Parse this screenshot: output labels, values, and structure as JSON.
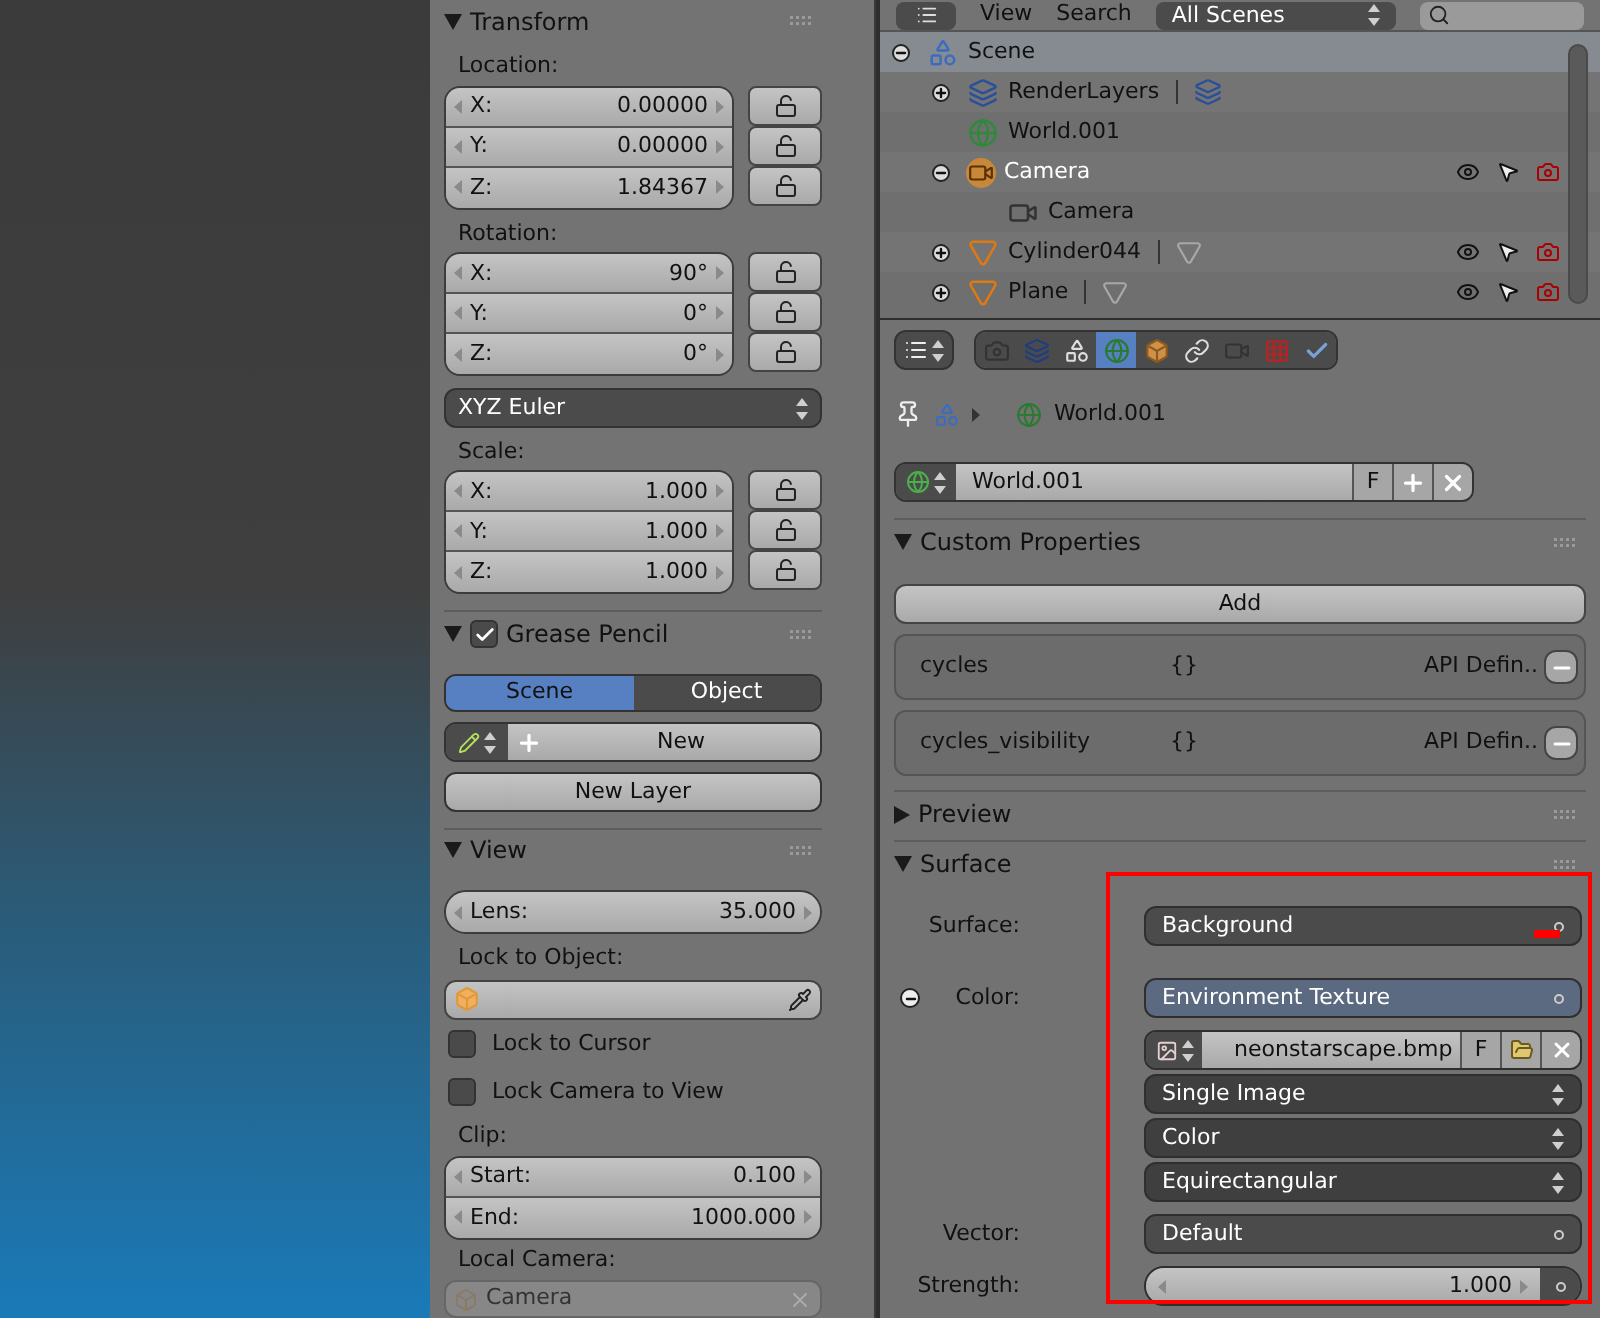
{
  "transform": {
    "title": "Transform",
    "expanded": true,
    "location": {
      "label": "Location:",
      "fields": [
        {
          "axis": "X:",
          "value": "0.00000"
        },
        {
          "axis": "Y:",
          "value": "0.00000"
        },
        {
          "axis": "Z:",
          "value": "1.84367"
        }
      ]
    },
    "rotation": {
      "label": "Rotation:",
      "fields": [
        {
          "axis": "X:",
          "value": "90°"
        },
        {
          "axis": "Y:",
          "value": "0°"
        },
        {
          "axis": "Z:",
          "value": "0°"
        }
      ]
    },
    "rotation_mode": "XYZ Euler",
    "scale": {
      "label": "Scale:",
      "fields": [
        {
          "axis": "X:",
          "value": "1.000"
        },
        {
          "axis": "Y:",
          "value": "1.000"
        },
        {
          "axis": "Z:",
          "value": "1.000"
        }
      ]
    }
  },
  "grease_pencil": {
    "title": "Grease Pencil",
    "expanded": true,
    "enabled": true,
    "tabs": [
      {
        "label": "Scene",
        "selected": true
      },
      {
        "label": "Object",
        "selected": false
      }
    ],
    "new_button": "New",
    "new_layer_button": "New Layer"
  },
  "view": {
    "title": "View",
    "expanded": true,
    "lens": {
      "label": "Lens:",
      "value": "35.000"
    },
    "lock_to_object_label": "Lock to Object:",
    "checkboxes": [
      {
        "label": "Lock to Cursor",
        "checked": false
      },
      {
        "label": "Lock Camera to View",
        "checked": false
      }
    ],
    "clip_label": "Clip:",
    "clip": [
      {
        "axis": "Start:",
        "value": "0.100"
      },
      {
        "axis": "End:",
        "value": "1000.000"
      }
    ],
    "local_camera_label": "Local Camera:",
    "local_camera": "Camera"
  },
  "outliner": {
    "menus": [
      "View",
      "Search"
    ],
    "scene_select": "All Scenes",
    "tree": [
      {
        "name": "Scene",
        "kind": "scene",
        "expanded": true,
        "selected": true,
        "active": false,
        "children": [
          {
            "name": "RenderLayers",
            "kind": "render_layers",
            "expanded": false,
            "selected": false,
            "active": false
          },
          {
            "name": "World.001",
            "kind": "world",
            "selected": false,
            "active": false
          },
          {
            "name": "Camera",
            "kind": "camera_object",
            "expanded": true,
            "selected": false,
            "active": true,
            "children": [
              {
                "name": "Camera",
                "kind": "camera_data",
                "selected": false,
                "active": false
              }
            ]
          },
          {
            "name": "Cylinder044",
            "kind": "mesh_object",
            "expanded": false,
            "selected": false,
            "active": false
          },
          {
            "name": "Plane",
            "kind": "mesh_object",
            "expanded": false,
            "selected": false,
            "active": false
          }
        ]
      }
    ]
  },
  "properties": {
    "context_tabs": [
      {
        "kind": "render",
        "selected": false
      },
      {
        "kind": "render_layers",
        "selected": false
      },
      {
        "kind": "scene",
        "selected": false
      },
      {
        "kind": "world",
        "selected": true
      },
      {
        "kind": "object",
        "selected": false
      },
      {
        "kind": "constraints",
        "selected": false
      },
      {
        "kind": "data",
        "selected": false
      },
      {
        "kind": "texture",
        "selected": false
      },
      {
        "kind": "physics",
        "selected": false
      }
    ],
    "breadcrumb": "World.001",
    "datablock": {
      "name": "World.001",
      "fake_user": "F"
    },
    "custom_properties": {
      "title": "Custom Properties",
      "expanded": true,
      "add_button": "Add",
      "items": [
        {
          "name": "cycles",
          "value": "{}",
          "type": "API Defin.."
        },
        {
          "name": "cycles_visibility",
          "value": "{}",
          "type": "API Defin.."
        }
      ]
    },
    "preview": {
      "title": "Preview",
      "expanded": false
    },
    "surface": {
      "title": "Surface",
      "expanded": true,
      "rows": [
        {
          "label": "Surface:",
          "kind": "menu",
          "value": "Background"
        },
        {
          "label": "Color:",
          "kind": "node",
          "value": "Environment Texture",
          "expanded": true
        },
        {
          "kind": "image",
          "value": "neonstarscape.bmp",
          "fake_user": "F"
        },
        {
          "kind": "dropdown",
          "value": "Single Image"
        },
        {
          "kind": "dropdown",
          "value": "Color"
        },
        {
          "kind": "dropdown",
          "value": "Equirectangular"
        },
        {
          "label": "Vector:",
          "kind": "menu",
          "value": "Default"
        },
        {
          "label": "Strength:",
          "kind": "number",
          "value": "1.000"
        }
      ]
    }
  }
}
